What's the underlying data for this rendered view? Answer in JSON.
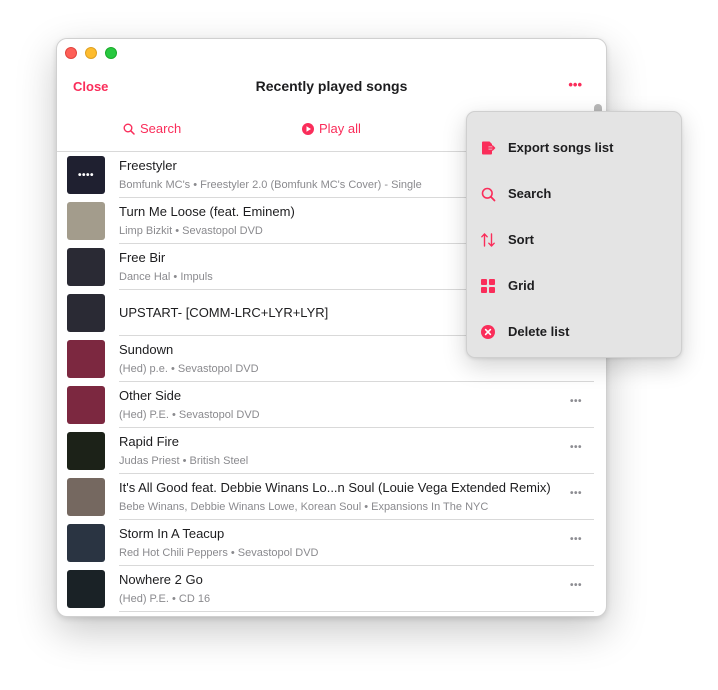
{
  "window": {
    "title": "Recently played songs",
    "close_label": "Close",
    "more_label": "•••"
  },
  "actions": {
    "search_label": "Search",
    "play_all_label": "Play all"
  },
  "songs": [
    {
      "title": "Freestyler",
      "subtitle": "Bomfunk MC's • Freestyler 2.0 (Bomfunk MC's Cover) - Single",
      "art_color": "#1f2030",
      "art_text": "••••"
    },
    {
      "title": "Turn Me Loose (feat. Eminem)",
      "subtitle": "Limp Bizkit • Sevastopol DVD",
      "art_color": "#a39c8c",
      "art_text": ""
    },
    {
      "title": "Free Bir",
      "subtitle": "Dance Hal • Impuls",
      "art_color": "#2a2a34",
      "art_text": ""
    },
    {
      "title": "UPSTART- [COMM-LRC+LYR+LYR]",
      "subtitle": "",
      "art_color": "#2a2a34",
      "art_text": ""
    },
    {
      "title": "Sundown",
      "subtitle": "(Hed) p.e. • Sevastopol DVD",
      "art_color": "#7c2840",
      "art_text": ""
    },
    {
      "title": "Other Side",
      "subtitle": "(Hed) P.E. • Sevastopol DVD",
      "art_color": "#7c2840",
      "art_text": ""
    },
    {
      "title": "Rapid Fire",
      "subtitle": "Judas Priest • British Steel",
      "art_color": "#1c2218",
      "art_text": ""
    },
    {
      "title": "It's All Good feat. Debbie Winans Lo...n Soul (Louie Vega Extended Remix)",
      "subtitle": "Bebe Winans, Debbie Winans Lowe, Korean Soul • Expansions In The NYC",
      "art_color": "#756860",
      "art_text": ""
    },
    {
      "title": "Storm In A Teacup",
      "subtitle": "Red Hot Chili Peppers • Sevastopol DVD",
      "art_color": "#2a3442",
      "art_text": ""
    },
    {
      "title": "Nowhere 2 Go",
      "subtitle": "(Hed) P.E. • CD 16",
      "art_color": "#1a2226",
      "art_text": ""
    }
  ],
  "row_more_label": "•••",
  "menu": {
    "items": [
      {
        "label": "Export songs list",
        "icon": "export-icon"
      },
      {
        "label": "Search",
        "icon": "search-icon"
      },
      {
        "label": "Sort",
        "icon": "sort-icon"
      },
      {
        "label": "Grid",
        "icon": "grid-icon"
      },
      {
        "label": "Delete list",
        "icon": "delete-icon"
      }
    ]
  },
  "colors": {
    "accent": "#fa2d5a",
    "menu_background": "#e4e4e4"
  }
}
